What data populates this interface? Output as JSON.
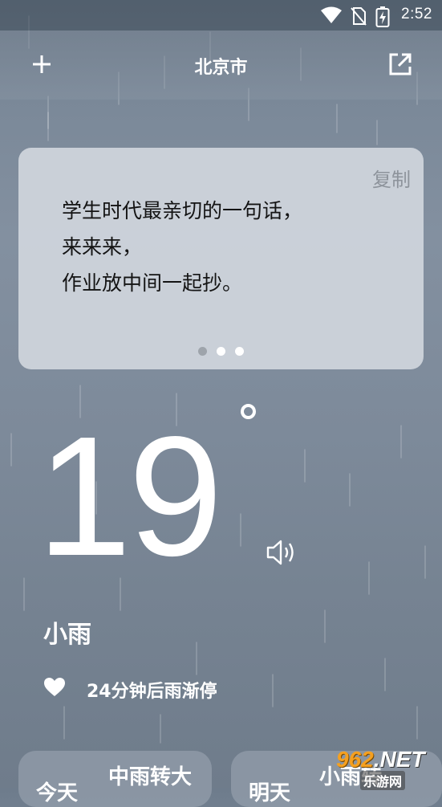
{
  "status_bar": {
    "time": "2:52",
    "icons": [
      "wifi-icon",
      "no-sim-icon",
      "battery-charging-icon"
    ]
  },
  "header": {
    "city": "北京市",
    "left_icon": "plus-icon",
    "right_icon": "share-external-icon"
  },
  "quote_card": {
    "copy_label": "复制",
    "lines": [
      "学生时代最亲切的一句话，",
      "来来来，",
      "作业放中间一起抄。"
    ],
    "page_count": 3,
    "active_page_index": 1
  },
  "current": {
    "temperature": "19",
    "degree_symbol": "degree-icon",
    "speaker_icon": "speaker-icon",
    "condition": "小雨",
    "forecast_icon": "heart-icon",
    "forecast_text": "24分钟后雨渐停"
  },
  "days": [
    {
      "label": "今天",
      "condition": "中雨转大"
    },
    {
      "label": "明天",
      "condition": "小雨转"
    }
  ],
  "watermark": {
    "main": "962",
    "suffix": ".NET",
    "sub": "乐游网"
  },
  "colors": {
    "background": "#7d8a9a",
    "card": "#d6dbe2",
    "text_dark": "#141414",
    "copy_gray": "#8d939b",
    "watermark_orange": "#f5a020"
  }
}
